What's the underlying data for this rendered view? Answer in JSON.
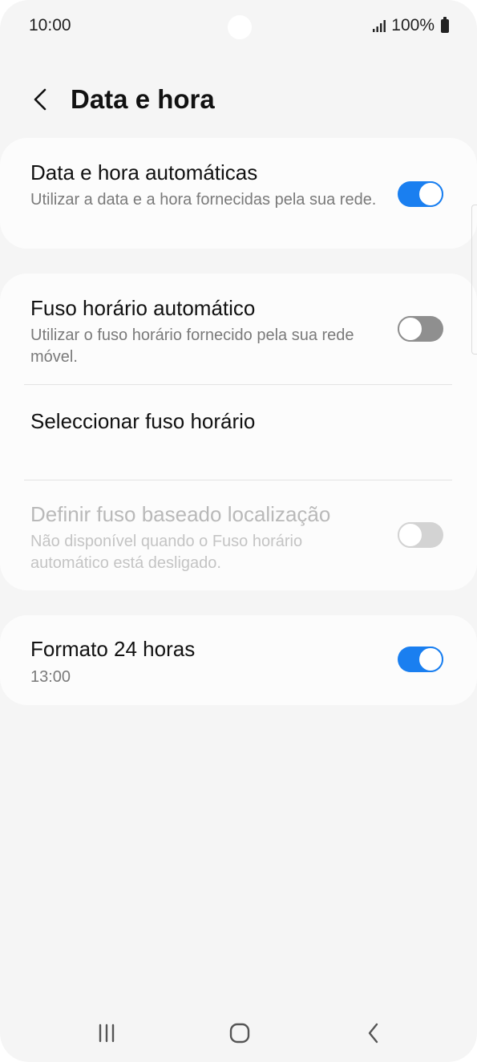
{
  "status_bar": {
    "time": "10:00",
    "battery_text": "100%",
    "icons": [
      "signal-icon",
      "battery-icon"
    ]
  },
  "header": {
    "title": "Data e hora",
    "back_icon": "chevron-left-icon"
  },
  "settings": {
    "auto_datetime": {
      "title": "Data e hora automáticas",
      "subtitle": "Utilizar a data e a hora fornecidas pela sua rede.",
      "toggle_on": true
    },
    "auto_timezone": {
      "title": "Fuso horário automático",
      "subtitle": "Utilizar o fuso horário fornecido pela sua rede móvel.",
      "toggle_on": false
    },
    "select_timezone": {
      "title": "Seleccionar fuso horário"
    },
    "location_timezone": {
      "title": "Definir fuso baseado localização",
      "subtitle": "Não disponível quando o Fuso horário automático está desligado.",
      "toggle_on": false,
      "enabled": false
    },
    "format_24h": {
      "title": "Formato 24 horas",
      "subtitle": "13:00",
      "toggle_on": true
    }
  },
  "nav_bar": {
    "icons": [
      "recent-apps-icon",
      "home-icon",
      "back-icon"
    ]
  },
  "colors": {
    "accent": "#1a7ff0",
    "background": "#f5f5f5",
    "card": "#fcfcfc",
    "toggle_off": "#8f8f8f"
  }
}
